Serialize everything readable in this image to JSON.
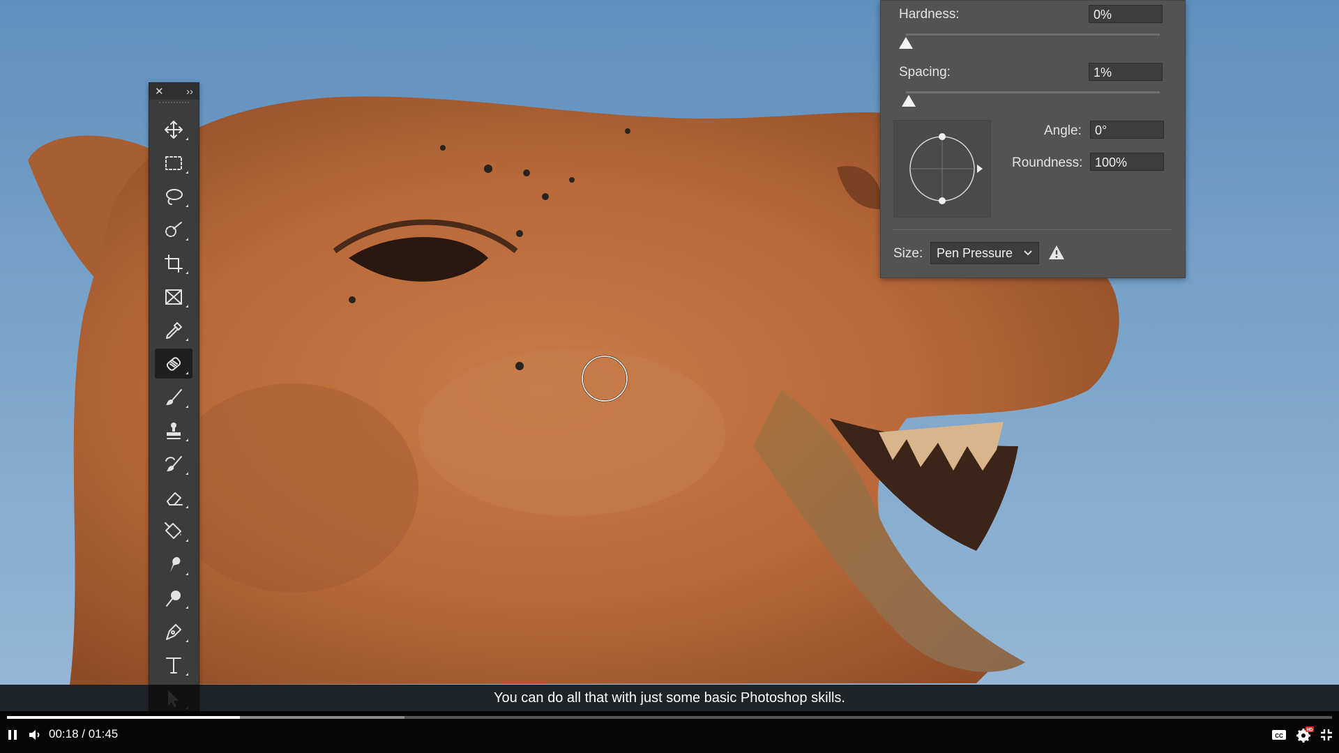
{
  "toolbar": {
    "close_glyph": "✕",
    "expand_glyph": "››",
    "tools": [
      {
        "name": "move-tool-icon",
        "active": false
      },
      {
        "name": "rectangular-marquee-tool-icon",
        "active": false
      },
      {
        "name": "lasso-tool-icon",
        "active": false
      },
      {
        "name": "quick-selection-tool-icon",
        "active": false
      },
      {
        "name": "crop-tool-icon",
        "active": false
      },
      {
        "name": "frame-tool-icon",
        "active": false
      },
      {
        "name": "eyedropper-tool-icon",
        "active": false
      },
      {
        "name": "spot-healing-brush-tool-icon",
        "active": true
      },
      {
        "name": "brush-tool-icon",
        "active": false
      },
      {
        "name": "clone-stamp-tool-icon",
        "active": false
      },
      {
        "name": "history-brush-tool-icon",
        "active": false
      },
      {
        "name": "eraser-tool-icon",
        "active": false
      },
      {
        "name": "paint-bucket-tool-icon",
        "active": false
      },
      {
        "name": "smudge-tool-icon",
        "active": false
      },
      {
        "name": "dodge-tool-icon",
        "active": false
      },
      {
        "name": "pen-tool-icon",
        "active": false
      },
      {
        "name": "type-tool-icon",
        "active": false
      },
      {
        "name": "path-selection-tool-icon",
        "active": false
      }
    ]
  },
  "panel": {
    "hardness_label": "Hardness:",
    "hardness_value": "0%",
    "hardness_level": 0,
    "spacing_label": "Spacing:",
    "spacing_value": "1%",
    "spacing_level": 0.01,
    "angle_label": "Angle:",
    "angle_value": "0°",
    "roundness_label": "Roundness:",
    "roundness_value": "100%",
    "size_label": "Size:",
    "size_control": "Pen Pressure",
    "warning_icon": "warning-icon"
  },
  "player": {
    "caption": "You can do all that with just some basic Photoshop skills.",
    "time": "00:18 / 01:45",
    "progress": 0.176,
    "buffered": 0.3,
    "accent": "#ffffff",
    "hd_badge_color": "#e52d27",
    "icons": [
      "pause-icon",
      "volume-icon",
      "captions-icon",
      "settings-icon",
      "exit-fullscreen-icon"
    ]
  }
}
